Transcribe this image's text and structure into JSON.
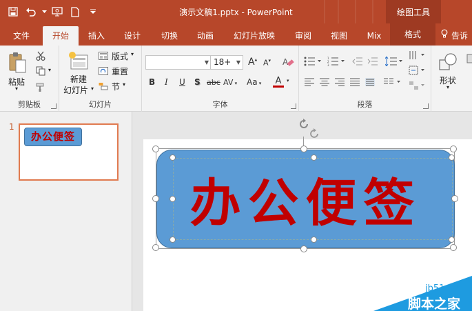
{
  "window": {
    "title": "演示文稿1.pptx - PowerPoint",
    "context_header": "绘图工具",
    "accent_color": "#b7472a"
  },
  "qat": {
    "icons": [
      "save-icon",
      "undo-icon",
      "present-from-beginning-icon",
      "new-file-icon",
      "customize-qat-icon"
    ]
  },
  "tabs": [
    {
      "label": "文件"
    },
    {
      "label": "开始"
    },
    {
      "label": "插入"
    },
    {
      "label": "设计"
    },
    {
      "label": "切换"
    },
    {
      "label": "动画"
    },
    {
      "label": "幻灯片放映"
    },
    {
      "label": "审阅"
    },
    {
      "label": "视图"
    },
    {
      "label": "Mix"
    },
    {
      "label": "格式"
    }
  ],
  "active_tab": "开始",
  "tell_me": "告诉",
  "ribbon": {
    "clipboard": {
      "paste": "粘贴",
      "label": "剪贴板"
    },
    "slides": {
      "new_slide_line1": "新建",
      "new_slide_line2": "幻灯片",
      "layout": "版式",
      "reset": "重置",
      "section": "节",
      "label": "幻灯片"
    },
    "font": {
      "font_name": "",
      "font_size": "18+",
      "bold": "B",
      "italic": "I",
      "underline": "U",
      "shadow": "S",
      "strike": "abc",
      "case": "Aa",
      "spacing": "AV",
      "grow": "A",
      "shrink": "A",
      "label": "字体"
    },
    "paragraph": {
      "label": "段落"
    },
    "shape": {
      "label": "形状"
    }
  },
  "slides_pane": {
    "slide_number": "1",
    "thumbnail_text": "办公便签"
  },
  "slide": {
    "shape_text": "办公便签",
    "shape_fill": "#5b9bd5",
    "text_color": "#c00000"
  },
  "watermark": {
    "url": "jb51.net",
    "name": "脚本之家"
  }
}
